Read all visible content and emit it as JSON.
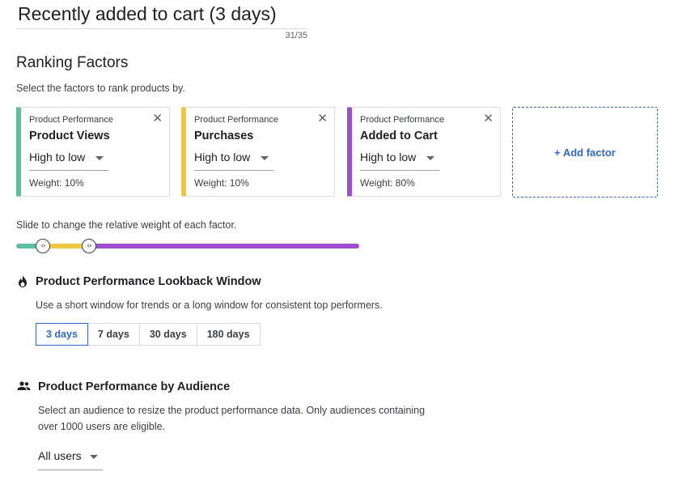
{
  "header": {
    "title": "Recently added to cart (3 days)",
    "counter": "31/35"
  },
  "ranking": {
    "heading": "Ranking Factors",
    "subtitle": "Select the factors to rank products by.",
    "factors": [
      {
        "category": "Product Performance",
        "name": "Product Views",
        "order": "High to low",
        "weight_label": "Weight: 10%",
        "weight": 10,
        "color": "#5ebf9e"
      },
      {
        "category": "Product Performance",
        "name": "Purchases",
        "order": "High to low",
        "weight_label": "Weight: 10%",
        "weight": 10,
        "color": "#f2c744"
      },
      {
        "category": "Product Performance",
        "name": "Added to Cart",
        "order": "High to low",
        "weight_label": "Weight: 80%",
        "weight": 80,
        "color": "#a04fd0"
      }
    ],
    "add_factor_label": "+ Add factor"
  },
  "slider": {
    "label": "Slide to change the relative weight of each factor.",
    "thumb_glyph": "‹›"
  },
  "lookback": {
    "icon": "fire-icon",
    "title": "Product Performance Lookback Window",
    "description": "Use a short window for trends or a long window for consistent top performers.",
    "options": [
      "3 days",
      "7 days",
      "30 days",
      "180 days"
    ],
    "selected": "3 days"
  },
  "audience": {
    "icon": "people-icon",
    "title": "Product Performance by Audience",
    "description_line1": "Select an audience to resize the product performance data. Only audiences containing",
    "description_line2": "over 1000 users are eligible.",
    "selected": "All users"
  },
  "colors": {
    "accent": "#3367d6"
  }
}
